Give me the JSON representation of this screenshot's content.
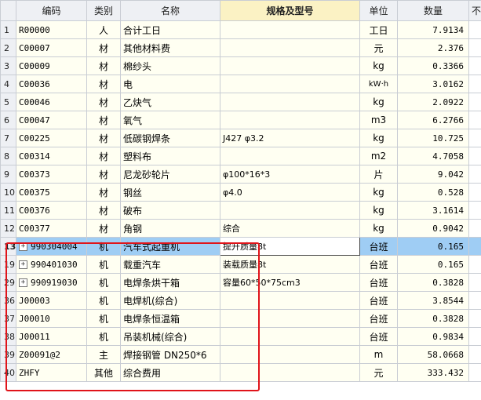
{
  "header": {
    "row_num": "",
    "code": "编码",
    "category": "类别",
    "name": "名称",
    "spec": "规格及型号",
    "unit": "单位",
    "quantity": "数量",
    "extra": "不"
  },
  "rows": [
    {
      "num": "1",
      "code": "R00000",
      "category": "人",
      "name": "合计工日",
      "spec": "",
      "unit": "工日",
      "quantity": "7.9134"
    },
    {
      "num": "2",
      "code": "C00007",
      "category": "材",
      "name": "其他材料费",
      "spec": "",
      "unit": "元",
      "quantity": "2.376"
    },
    {
      "num": "3",
      "code": "C00009",
      "category": "材",
      "name": "棉纱头",
      "spec": "",
      "unit": "kg",
      "quantity": "0.3366"
    },
    {
      "num": "4",
      "code": "C00036",
      "category": "材",
      "name": "电",
      "spec": "",
      "unit": "kW·h",
      "quantity": "3.0162"
    },
    {
      "num": "5",
      "code": "C00046",
      "category": "材",
      "name": "乙炔气",
      "spec": "",
      "unit": "kg",
      "quantity": "2.0922"
    },
    {
      "num": "6",
      "code": "C00047",
      "category": "材",
      "name": "氧气",
      "spec": "",
      "unit": "m3",
      "quantity": "6.2766"
    },
    {
      "num": "7",
      "code": "C00225",
      "category": "材",
      "name": "低碳钢焊条",
      "spec": "J427 φ3.2",
      "unit": "kg",
      "quantity": "10.725"
    },
    {
      "num": "8",
      "code": "C00314",
      "category": "材",
      "name": "塑料布",
      "spec": "",
      "unit": "m2",
      "quantity": "4.7058"
    },
    {
      "num": "9",
      "code": "C00373",
      "category": "材",
      "name": "尼龙砂轮片",
      "spec": "φ100*16*3",
      "unit": "片",
      "quantity": "9.042"
    },
    {
      "num": "10",
      "code": "C00375",
      "category": "材",
      "name": "钢丝",
      "spec": "φ4.0",
      "unit": "kg",
      "quantity": "0.528"
    },
    {
      "num": "11",
      "code": "C00376",
      "category": "材",
      "name": "破布",
      "spec": "",
      "unit": "kg",
      "quantity": "3.1614"
    },
    {
      "num": "12",
      "code": "C00377",
      "category": "材",
      "name": "角钢",
      "spec": "综合",
      "unit": "kg",
      "quantity": "0.9042"
    },
    {
      "num": "13",
      "code": "990304004",
      "category": "机",
      "name": "汽车式起重机",
      "spec": "提升质量8t",
      "unit": "台班",
      "quantity": "0.165",
      "expand": "+",
      "selected": true
    },
    {
      "num": "19",
      "code": "990401030",
      "category": "机",
      "name": "载重汽车",
      "spec": "装载质量8t",
      "unit": "台班",
      "quantity": "0.165",
      "expand": "+"
    },
    {
      "num": "29",
      "code": "990919030",
      "category": "机",
      "name": "电焊条烘干箱",
      "spec": "容量60*50*75cm3",
      "unit": "台班",
      "quantity": "0.3828",
      "expand": "+"
    },
    {
      "num": "36",
      "code": "J00003",
      "category": "机",
      "name": "电焊机(综合)",
      "spec": "",
      "unit": "台班",
      "quantity": "3.8544"
    },
    {
      "num": "37",
      "code": "J00010",
      "category": "机",
      "name": "电焊条恒温箱",
      "spec": "",
      "unit": "台班",
      "quantity": "0.3828"
    },
    {
      "num": "38",
      "code": "J00011",
      "category": "机",
      "name": "吊装机械(综合)",
      "spec": "",
      "unit": "台班",
      "quantity": "0.9834"
    },
    {
      "num": "39",
      "code": "Z00091@2",
      "category": "主",
      "name": "焊接钢管 DN250*6",
      "spec": "",
      "unit": "m",
      "quantity": "58.0668"
    },
    {
      "num": "40",
      "code": "ZHFY",
      "category": "其他",
      "name": "综合费用",
      "spec": "",
      "unit": "元",
      "quantity": "333.432"
    }
  ],
  "colors": {
    "selected_row": "#9fcdf4",
    "cell_bg": "#fffff2",
    "header_bg": "#eef0f4",
    "spec_header_bg": "#fbf2c4",
    "annotation_box": "#e0141a"
  }
}
